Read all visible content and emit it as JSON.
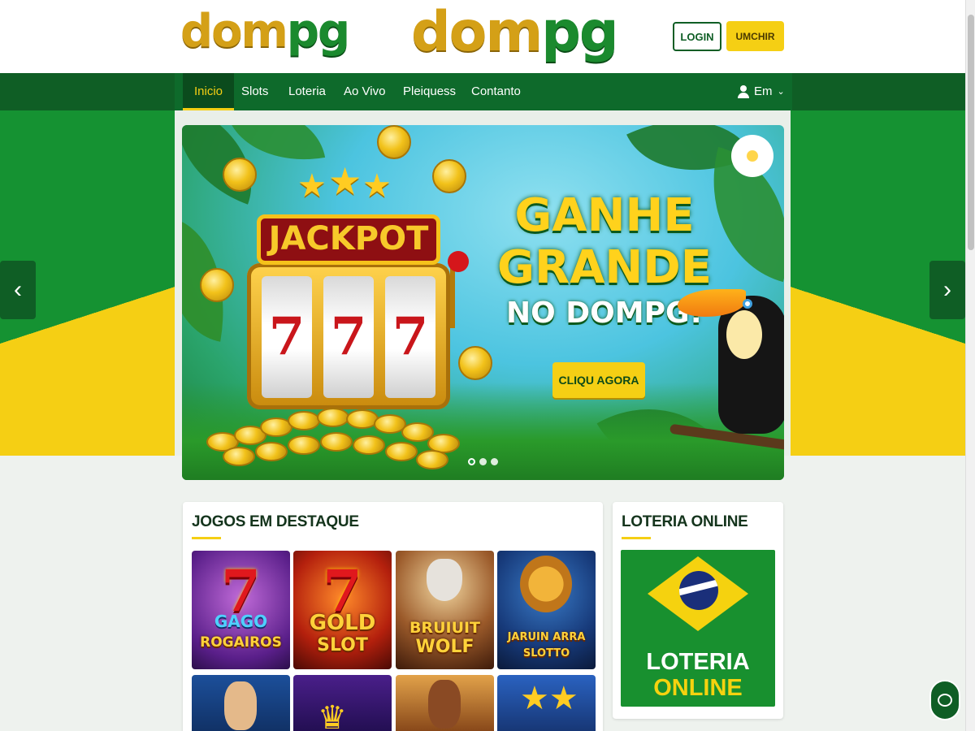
{
  "header": {
    "logo_left": {
      "part_a": "dom",
      "part_b": "pg"
    },
    "logo_center": {
      "part_a": "dom",
      "part_b": "pg"
    },
    "login_label": "LOGIN",
    "register_label": "UMCHIR"
  },
  "nav": {
    "items": [
      {
        "label": "Inicio",
        "active": true
      },
      {
        "label": "Slots"
      },
      {
        "label": "Loteria"
      },
      {
        "label": "Ao Vivo"
      },
      {
        "label": "Pleiquess"
      },
      {
        "label": "Contanto"
      }
    ],
    "language_label": "Em"
  },
  "banner": {
    "jackpot_label": "JACKPOT",
    "reel_symbol": "7",
    "headline_line1": "GANHE",
    "headline_line2": "GRANDE",
    "headline_line3": "NO DOMPG!",
    "cta_label": "CLIQU AGORA",
    "slides": 3,
    "active_slide": 1,
    "arrow_prev": "‹",
    "arrow_next": "›"
  },
  "featured_games": {
    "title": "JOGOS EM DESTAQUE",
    "games": [
      {
        "line1": "GAGO",
        "line2": "ROGAIROS"
      },
      {
        "line1": "GOLD",
        "line2": "SLOT"
      },
      {
        "line1": "BRUIUIT",
        "line2": "WOLF"
      },
      {
        "line1": "JARUIN ARRA",
        "line2": "SLOTTO"
      }
    ]
  },
  "lottery": {
    "title": "LOTERIA ONLINE",
    "image_line1": "LOTERIA",
    "image_line2": "ONLINE"
  },
  "colors": {
    "brand_green": "#0f5e25",
    "brand_yellow": "#f5cf14",
    "accent_gold": "#d4a017"
  },
  "icons": [
    "user-icon",
    "chevron-down-icon",
    "chevron-left-icon",
    "chevron-right-icon",
    "chat-icon"
  ]
}
